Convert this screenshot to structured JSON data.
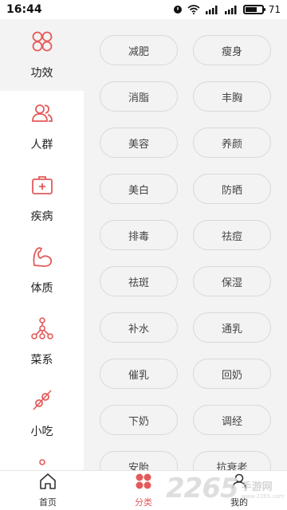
{
  "status_bar": {
    "time": "16:44",
    "battery": "71",
    "battery_level": 0.71
  },
  "sidebar": {
    "items": [
      {
        "label": "功效",
        "icon": "four-circles-icon"
      },
      {
        "label": "人群",
        "icon": "people-icon"
      },
      {
        "label": "疾病",
        "icon": "medical-kit-icon"
      },
      {
        "label": "体质",
        "icon": "muscle-arm-icon"
      },
      {
        "label": "菜系",
        "icon": "network-icon"
      },
      {
        "label": "小吃",
        "icon": "skewer-icon"
      }
    ]
  },
  "tags": [
    "减肥",
    "瘦身",
    "消脂",
    "丰胸",
    "美容",
    "养颜",
    "美白",
    "防晒",
    "排毒",
    "祛痘",
    "祛斑",
    "保湿",
    "补水",
    "通乳",
    "催乳",
    "回奶",
    "下奶",
    "调经",
    "安胎",
    "抗衰老"
  ],
  "tabbar": {
    "home": "首页",
    "category": "分类",
    "mine": "我的"
  },
  "watermark": {
    "number": "2265",
    "text": "手游网",
    "url": "www.2265.com"
  },
  "colors": {
    "accent": "#e45a5a",
    "sidebar_bg": "#f3f3f3",
    "tag_border": "#d9d9d9"
  }
}
